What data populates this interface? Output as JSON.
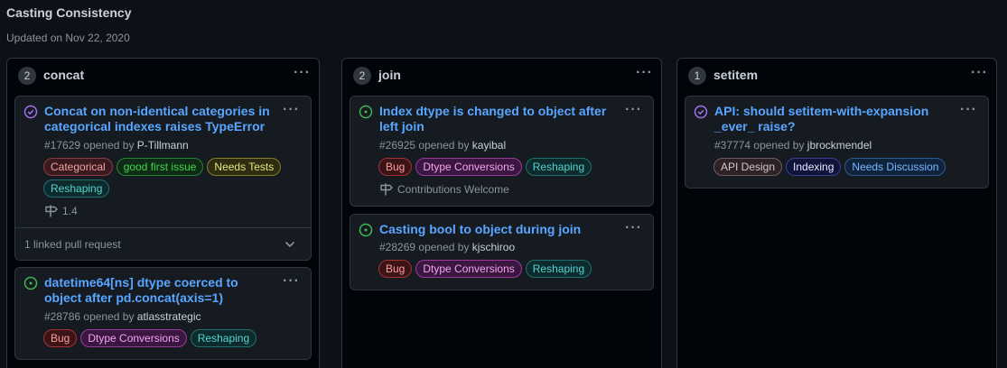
{
  "project": {
    "title": "Casting Consistency",
    "updated": "Updated on Nov 22, 2020"
  },
  "columns": [
    {
      "count": "2",
      "name": "concat",
      "cards": [
        {
          "title": "Concat on non-identical categories in categorical indexes raises TypeError",
          "number": "#17629",
          "opened_by": "opened by",
          "author": "P-Tillmann",
          "status": "closed",
          "labels": [
            "Categorical",
            "good first issue",
            "Needs Tests",
            "Reshaping"
          ],
          "milestone": "1.4",
          "linked": "1 linked pull request"
        },
        {
          "title": "datetime64[ns] dtype coerced to object after pd.concat(axis=1)",
          "number": "#28786",
          "opened_by": "opened by",
          "author": "atlasstrategic",
          "status": "open",
          "labels": [
            "Bug",
            "Dtype Conversions",
            "Reshaping"
          ]
        }
      ]
    },
    {
      "count": "2",
      "name": "join",
      "cards": [
        {
          "title": "Index dtype is changed to object after left join",
          "number": "#26925",
          "opened_by": "opened by",
          "author": "kayibal",
          "status": "open",
          "labels": [
            "Bug",
            "Dtype Conversions",
            "Reshaping"
          ],
          "milestone": "Contributions Welcome"
        },
        {
          "title": "Casting bool to object during join",
          "number": "#28269",
          "opened_by": "opened by",
          "author": "kjschiroo",
          "status": "open",
          "labels": [
            "Bug",
            "Dtype Conversions",
            "Reshaping"
          ]
        }
      ]
    },
    {
      "count": "1",
      "name": "setitem",
      "cards": [
        {
          "title": "API: should setitem-with-expansion _ever_ raise?",
          "number": "#37774",
          "opened_by": "opened by",
          "author": "jbrockmendel",
          "status": "closed",
          "labels": [
            "API Design",
            "Indexing",
            "Needs Discussion"
          ]
        }
      ]
    }
  ],
  "label_colors": {
    "Categorical": {
      "fg": "#f0a3a3",
      "bg": "#3a1a1e",
      "border": "#8b3a3f"
    },
    "good first issue": {
      "fg": "#3fd64a",
      "bg": "#0f2b16",
      "border": "#238636"
    },
    "Needs Tests": {
      "fg": "#e6e67a",
      "bg": "#2e2d12",
      "border": "#807d2b"
    },
    "Reshaping": {
      "fg": "#56d4cf",
      "bg": "#0d2b2d",
      "border": "#1f6f70"
    },
    "Bug": {
      "fg": "#ff9e9e",
      "bg": "#3b1416",
      "border": "#a33237"
    },
    "Dtype Conversions": {
      "fg": "#f4a4f0",
      "bg": "#3a1640",
      "border": "#9a3b9a"
    },
    "API Design": {
      "fg": "#d8c5c8",
      "bg": "#2d2326",
      "border": "#6e5a5e"
    },
    "Indexing": {
      "fg": "#e6e6ff",
      "bg": "#10143a",
      "border": "#3a3f8f"
    },
    "Needs Discussion": {
      "fg": "#79b8ff",
      "bg": "#10233d",
      "border": "#2f5a8f"
    }
  },
  "icons": {
    "open": "issue-open-icon",
    "closed": "issue-closed-icon",
    "milestone": "milestone-icon",
    "chevron": "chevron-down-icon"
  }
}
